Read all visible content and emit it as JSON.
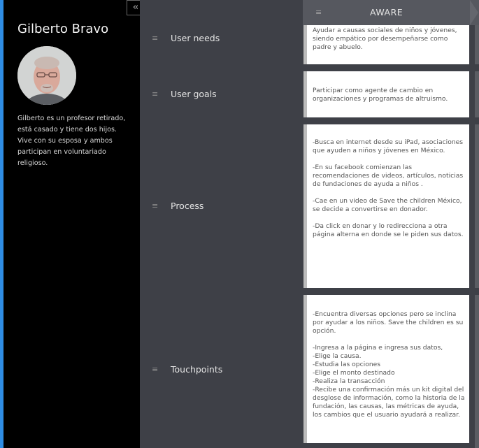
{
  "profile": {
    "collapse_icon": "double-chevron-left",
    "name": "Gilberto Bravo",
    "description": "Gilberto es un profesor retirado, está casado y tiene dos hijos. Vive con su esposa y ambos participan en voluntariado religioso."
  },
  "stage": {
    "title": "AWARE",
    "handle_icon": "drag-handle-icon"
  },
  "rows": [
    {
      "label": "User needs"
    },
    {
      "label": "User goals"
    },
    {
      "label": "Process"
    },
    {
      "label": "Touchpoints"
    }
  ],
  "cards": {
    "needs": "Ayudar a causas sociales de niños y jóvenes, siendo empático por desempeñarse como padre y abuelo.",
    "goals": "Participar como agente de cambio en organizaciones y programas de altruismo.",
    "process": [
      "-Busca en internet desde su iPad, asociaciones que ayuden a niños y jóvenes en México.",
      "-En su facebook comienzan las recomendaciones de videos, artículos, noticias de fundaciones de ayuda a niños .",
      "-Cae en un video de Save the children México, se decide a convertirse en donador.",
      "-Da click en donar y lo redirecciona a otra página alterna en donde se le piden sus datos."
    ],
    "touchpoints": [
      "-Encuentra diversas opciones pero se inclina por ayudar a los niños. Save the children es su opción.",
      "-Ingresa a la página e ingresa sus datos,\n-Elige la causa.\n-Estudia las opciones\n-Elige el monto destinado\n-Realiza la transacción\n-Recibe una confirmación más un kit digital del desglose de información, como la historia de la fundación, las causas, las métricas de ayuda, los cambios que el usuario ayudará a realizar."
    ]
  }
}
